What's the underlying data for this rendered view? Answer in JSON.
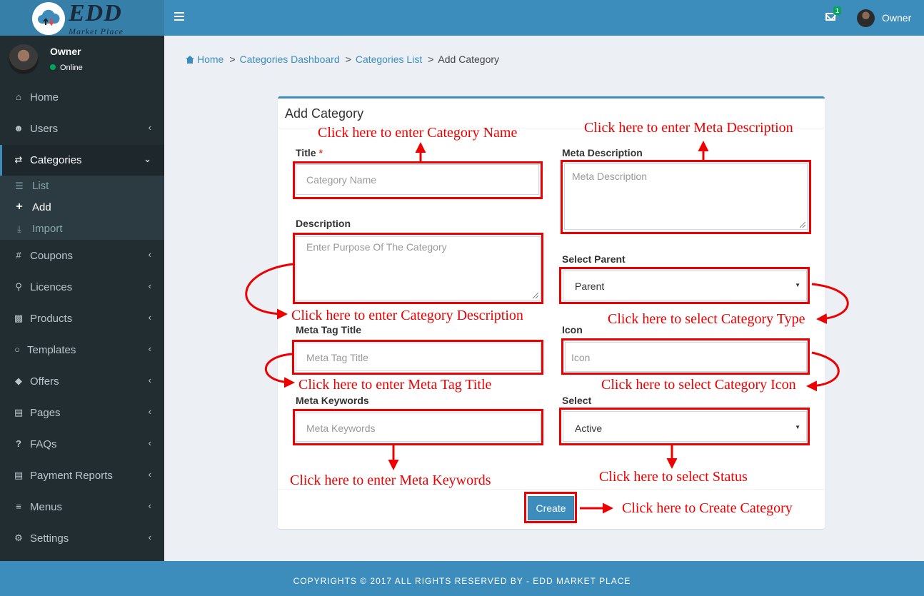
{
  "brand": {
    "logo_main": "EDD",
    "logo_sub": "Market Place"
  },
  "topbar": {
    "mail_badge": "1",
    "user_name": "Owner"
  },
  "sidebar": {
    "user": {
      "name": "Owner",
      "status": "Online"
    },
    "items": [
      {
        "label": "Home",
        "icon": "home-icon"
      },
      {
        "label": "Users",
        "icon": "users-icon"
      },
      {
        "label": "Categories",
        "icon": "shuffle-icon"
      },
      {
        "label": "Coupons",
        "icon": "hash-icon"
      },
      {
        "label": "Licences",
        "icon": "key-icon"
      },
      {
        "label": "Products",
        "icon": "shopping-bag-icon"
      },
      {
        "label": "Templates",
        "icon": "comment-icon"
      },
      {
        "label": "Offers",
        "icon": "tags-icon"
      },
      {
        "label": "Pages",
        "icon": "file-icon"
      },
      {
        "label": "FAQs",
        "icon": "question-icon"
      },
      {
        "label": "Payment Reports",
        "icon": "file-icon"
      },
      {
        "label": "Menus",
        "icon": "bars-icon"
      },
      {
        "label": "Settings",
        "icon": "gear-icon"
      }
    ],
    "submenu": [
      {
        "label": "List",
        "icon": "list-icon"
      },
      {
        "label": "Add",
        "icon": "plus-icon"
      },
      {
        "label": "Import",
        "icon": "download-icon"
      }
    ]
  },
  "breadcrumb": [
    "Home",
    "Categories Dashboard",
    "Categories List",
    "Add Category"
  ],
  "form": {
    "title": "Add Category",
    "title_label": "Title",
    "title_placeholder": "Category Name",
    "meta_description_label": "Meta Description",
    "meta_description_placeholder": "Meta Description",
    "description_label": "Description",
    "description_placeholder": "Enter Purpose Of The Category",
    "select_parent_label": "Select Parent",
    "select_parent_value": "Parent",
    "meta_tag_title_label": "Meta Tag Title",
    "meta_tag_title_placeholder": "Meta Tag Title",
    "icon_label": "Icon",
    "icon_placeholder": "Icon",
    "meta_keywords_label": "Meta Keywords",
    "meta_keywords_placeholder": "Meta Keywords",
    "status_label": "Select",
    "status_value": "Active",
    "create_label": "Create"
  },
  "annotations": {
    "category_name": "Click here to enter Category Name",
    "meta_description": "Click here to enter Meta Description",
    "category_description": "Click here to enter Category Description",
    "category_type": "Click here to select Category Type",
    "meta_tag_title": "Click here to enter Meta Tag Title",
    "category_icon": "Click here to select Category Icon",
    "meta_keywords": "Click here to enter Meta Keywords",
    "status": "Click here to select Status",
    "create": "Click here to Create Category"
  },
  "colors": {
    "accent": "#3c8dbc",
    "sidebar_bg": "#222d32",
    "annotation": "#ee0000"
  },
  "footer": {
    "text": "COPYRIGHTS © 2017 ALL RIGHTS RESERVED BY - EDD MARKET PLACE"
  }
}
